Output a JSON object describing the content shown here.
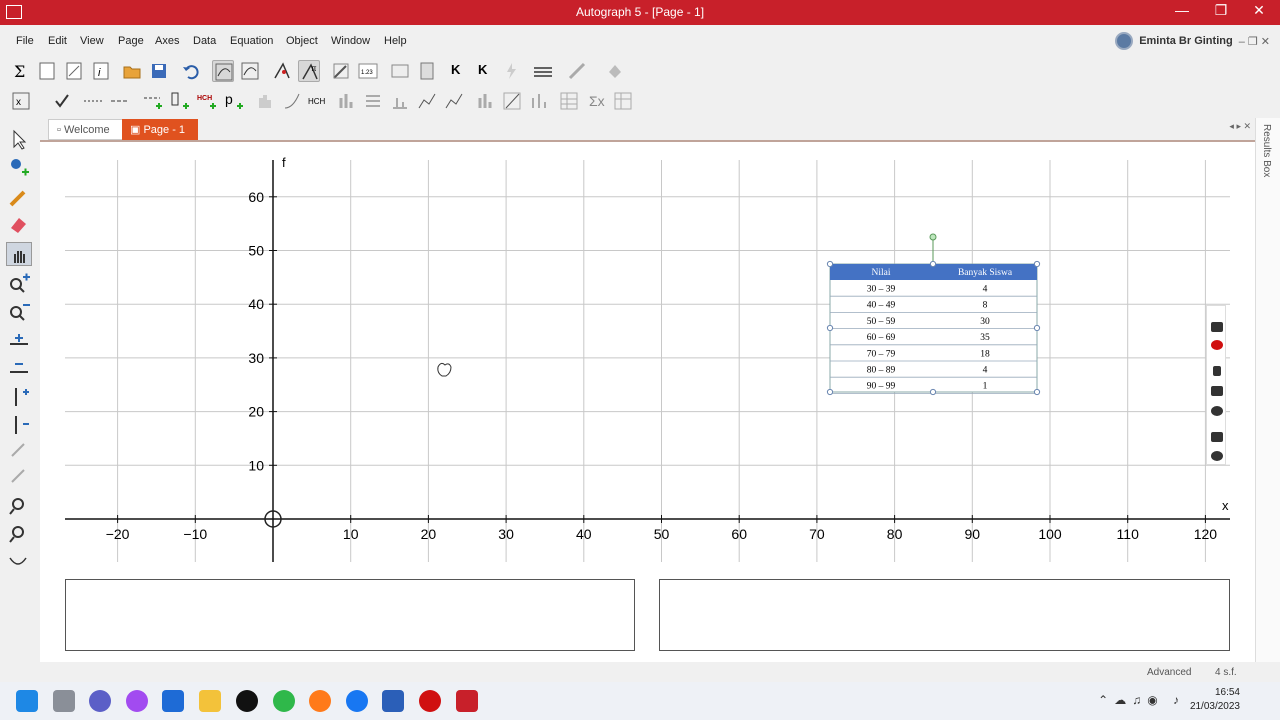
{
  "titlebar": {
    "title": "Autograph 5 - [Page - 1]",
    "minimize": "—",
    "restore": "❐",
    "close": "✕"
  },
  "menu": [
    "File",
    "Edit",
    "View",
    "Page",
    "Axes",
    "Data",
    "Equation",
    "Object",
    "Window",
    "Help"
  ],
  "user": {
    "name": "Eminta Br Ginting",
    "controls": "–  ❐  ✕"
  },
  "tabs": {
    "welcome": "Welcome",
    "page": "Page - 1"
  },
  "results_box": "Results Box",
  "graph": {
    "y_label": "f",
    "x_label": "x",
    "x_ticks": [
      "−20",
      "−10",
      "10",
      "20",
      "30",
      "40",
      "50",
      "60",
      "70",
      "80",
      "90",
      "100",
      "110",
      "120"
    ],
    "y_ticks": [
      "10",
      "20",
      "30",
      "40",
      "50",
      "60"
    ]
  },
  "table": {
    "headers": [
      "Nilai",
      "Banyak Siswa"
    ],
    "rows": [
      [
        "30 – 39",
        "4"
      ],
      [
        "40 – 49",
        "8"
      ],
      [
        "50 – 59",
        "30"
      ],
      [
        "60 – 69",
        "35"
      ],
      [
        "70 – 79",
        "18"
      ],
      [
        "80 – 89",
        "4"
      ],
      [
        "90 – 99",
        "1"
      ]
    ]
  },
  "status": {
    "mode": "Advanced",
    "sf": "4 s.f."
  },
  "clock": {
    "time": "16:54",
    "date": "21/03/2023"
  },
  "colors": {
    "titlebar": "#c8202a",
    "tab_active": "#e0521f",
    "table_header": "#4472c4",
    "grid": "#c8c8c8"
  }
}
